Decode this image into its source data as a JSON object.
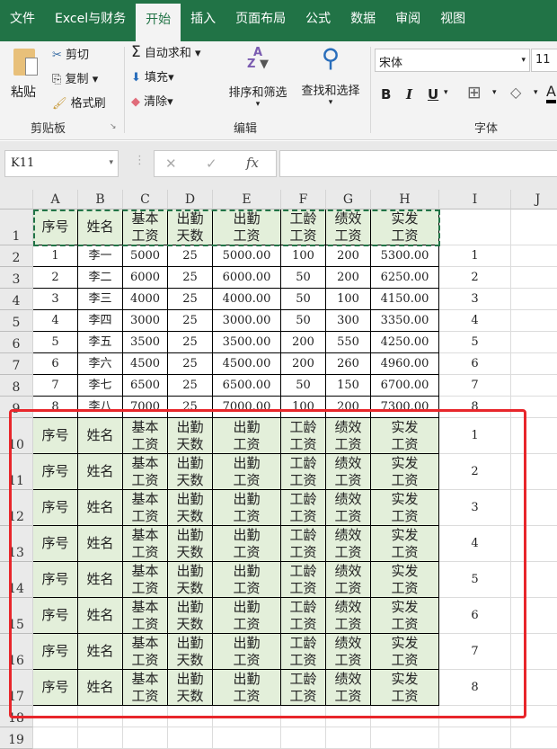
{
  "tabs": [
    "文件",
    "Excel与财务",
    "开始",
    "插入",
    "页面布局",
    "公式",
    "数据",
    "审阅",
    "视图"
  ],
  "active_tab": "开始",
  "ribbon": {
    "paste": "粘贴",
    "cut": "剪切",
    "copy": "复制",
    "format_painter": "格式刷",
    "clipboard_group": "剪贴板",
    "autosum": "自动求和",
    "fill": "填充",
    "clear": "清除",
    "sort_filter": "排序和筛选",
    "find_select": "查找和选择",
    "editing_group": "编辑",
    "font_name": "宋体",
    "font_size": "11",
    "bold": "B",
    "italic": "I",
    "underline": "U",
    "font_group": "字体"
  },
  "formula_bar": {
    "name_box": "K11",
    "cancel": "✕",
    "enter": "✓",
    "fx": "fx",
    "formula": ""
  },
  "columns": [
    "A",
    "B",
    "C",
    "D",
    "E",
    "F",
    "G",
    "H",
    "I",
    "J"
  ],
  "row_numbers": [
    "1",
    "2",
    "3",
    "4",
    "5",
    "6",
    "7",
    "8",
    "9",
    "10",
    "11",
    "12",
    "13",
    "14",
    "15",
    "16",
    "17",
    "18",
    "19"
  ],
  "header_row": [
    "序号",
    "姓名",
    "基本\n工资",
    "出勤\n天数",
    "出勤\n工资",
    "工龄\n工资",
    "绩效\n工资",
    "实发\n工资"
  ],
  "data_rows": [
    [
      "1",
      "李一",
      "5000",
      "25",
      "5000.00",
      "100",
      "200",
      "5300.00",
      "1"
    ],
    [
      "2",
      "李二",
      "6000",
      "25",
      "6000.00",
      "50",
      "200",
      "6250.00",
      "2"
    ],
    [
      "3",
      "李三",
      "4000",
      "25",
      "4000.00",
      "50",
      "100",
      "4150.00",
      "3"
    ],
    [
      "4",
      "李四",
      "3000",
      "25",
      "3000.00",
      "50",
      "300",
      "3350.00",
      "4"
    ],
    [
      "5",
      "李五",
      "3500",
      "25",
      "3500.00",
      "200",
      "550",
      "4250.00",
      "5"
    ],
    [
      "6",
      "李六",
      "4500",
      "25",
      "4500.00",
      "200",
      "260",
      "4960.00",
      "6"
    ],
    [
      "7",
      "李七",
      "6500",
      "25",
      "6500.00",
      "50",
      "150",
      "6700.00",
      "7"
    ],
    [
      "8",
      "李八",
      "7000",
      "25",
      "7000.00",
      "100",
      "200",
      "7300.00",
      "8"
    ]
  ],
  "repeated_header_helper": [
    "1",
    "2",
    "3",
    "4",
    "5",
    "6",
    "7",
    "8"
  ],
  "colors": {
    "accent": "#217346",
    "header_fill": "#e3efda",
    "highlight": "#e8262b"
  }
}
